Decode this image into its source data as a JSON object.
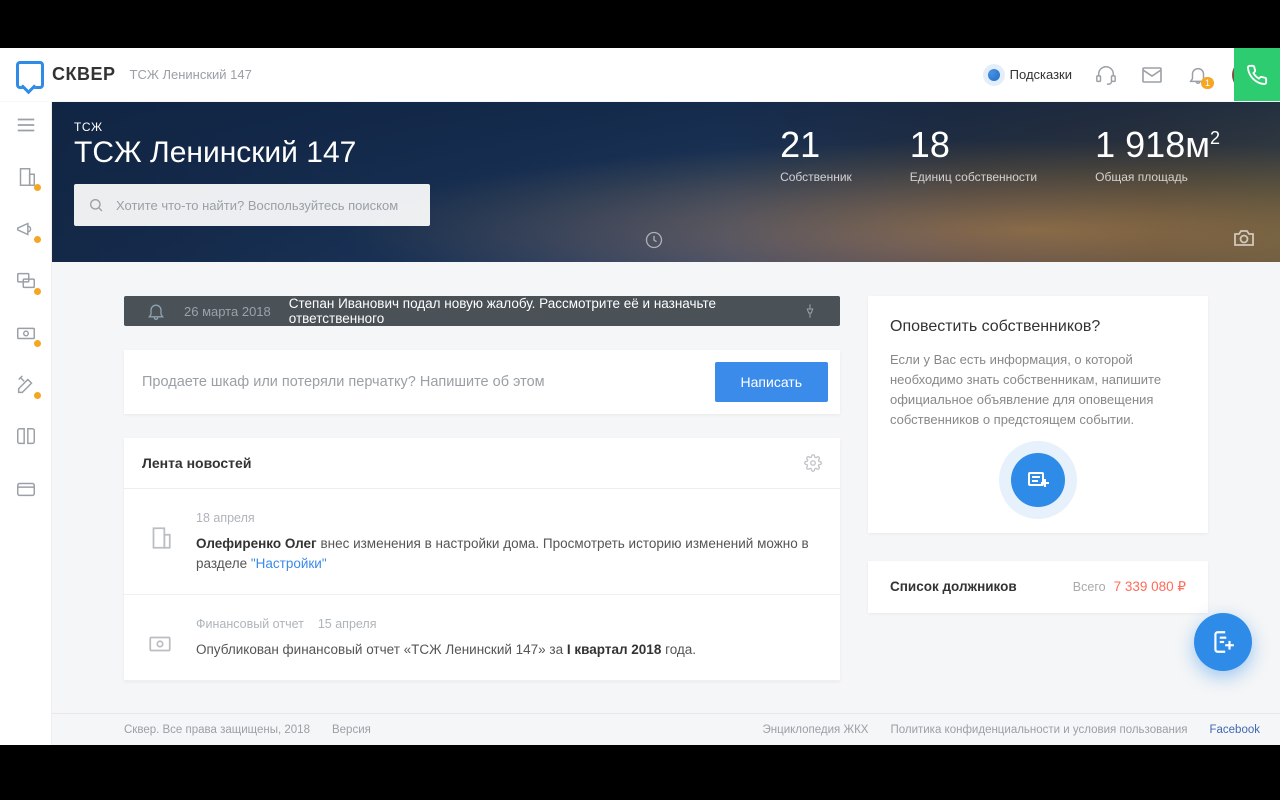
{
  "header": {
    "brand": "СКВЕР",
    "brand_sub": "ТСЖ Ленинский 147",
    "hints_label": "Подсказки",
    "bell_badge": "1"
  },
  "hero": {
    "tag": "ТСЖ",
    "title": "ТСЖ Ленинский 147",
    "search_placeholder": "Хотите что-то найти? Воспользуйтесь поиском",
    "stats": [
      {
        "value": "21",
        "label": "Собственник"
      },
      {
        "value": "18",
        "label": "Единиц собственности"
      },
      {
        "value": "1 918",
        "unit": "м",
        "sup": "2",
        "label": "Общая площадь"
      }
    ]
  },
  "notice": {
    "date": "26 марта 2018",
    "text": "Степан Иванович подал новую жалобу. Рассмотрите её и назначьте ответственного"
  },
  "composer": {
    "placeholder": "Продаете шкаф или потеряли перчатку? Напишите об этом",
    "button": "Написать"
  },
  "feed": {
    "title": "Лента новостей",
    "items": [
      {
        "meta_category": "",
        "meta_date": "18 апреля",
        "author": "Олефиренко Олег",
        "text_rest": " внес изменения в настройки дома. Просмотреть историю изменений можно в разделе ",
        "link_text": "\"Настройки\""
      },
      {
        "meta_category": "Финансовый отчет",
        "meta_date": "15 апреля",
        "text_prefix": "Опубликован финансовый отчет «ТСЖ Ленинский 147» за ",
        "text_bold": "I квартал 2018",
        "text_suffix": " года."
      }
    ]
  },
  "notify_card": {
    "title": "Оповестить собственников?",
    "text": "Если у Вас есть информация, о которой необходимо знать собственникам, напишите официальное объявление для оповещения собственников о предстоящем событии."
  },
  "debtors": {
    "title": "Список должников",
    "total_label": "Всего",
    "total_value": "7 339 080",
    "currency": "₽"
  },
  "footer": {
    "copyright": "Сквер. Все права защищены, 2018",
    "version_label": "Версия",
    "links": {
      "wiki": "Энциклопедия ЖКХ",
      "policy": "Политика конфиденциальности и условия пользования",
      "fb": "Facebook"
    }
  }
}
